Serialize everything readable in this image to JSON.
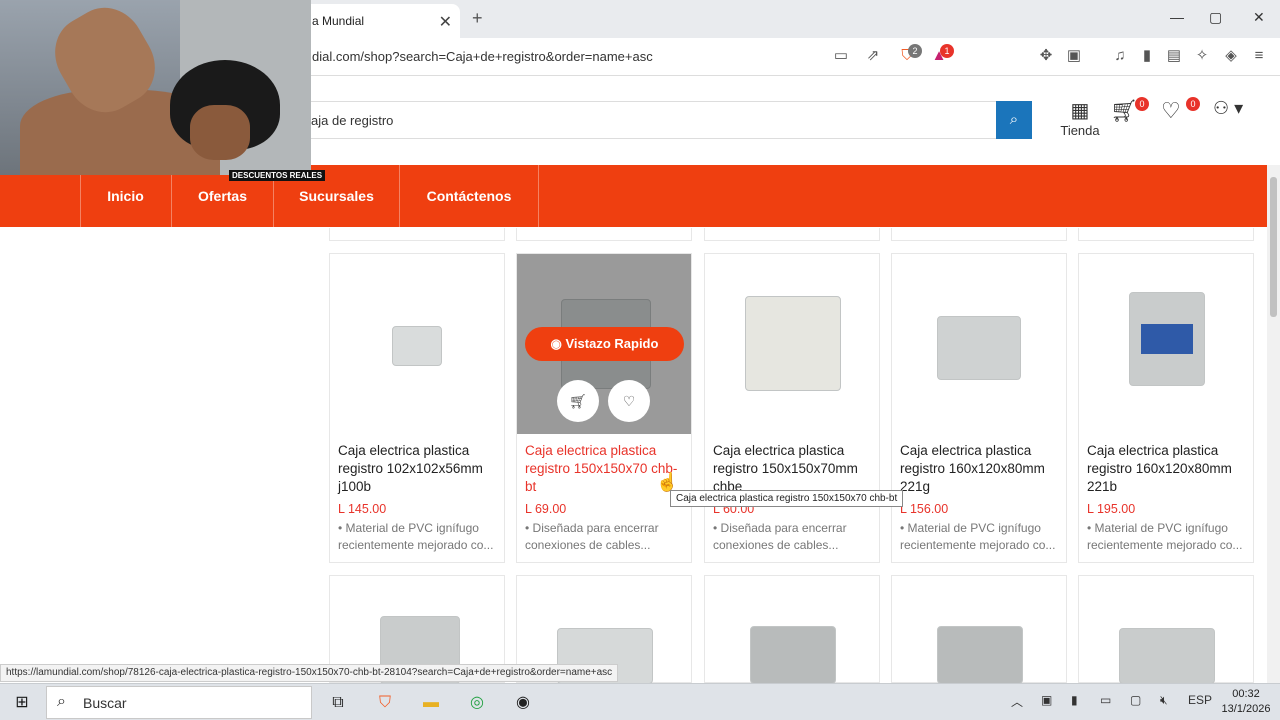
{
  "browser": {
    "tab_title": "a Mundial",
    "tab_close": "✕",
    "new_tab": "+",
    "window_controls": [
      "—",
      "▢",
      "✕"
    ],
    "url": "dial.com/shop?search=Caja+de+registro&order=name+asc",
    "shield_badge": "2",
    "alert_badge": "1"
  },
  "webcam": {
    "tag": "DESCUENTOS REALES"
  },
  "header": {
    "search_value": "aja de registro",
    "store_label": "Tienda",
    "cart_count": "0",
    "wishlist_count": "0"
  },
  "nav": {
    "items": [
      "Inicio",
      "Ofertas",
      "Sucursales",
      "Contáctenos"
    ]
  },
  "products": [
    {
      "title": "Caja electrica plastica registro 102x102x56mm j100b",
      "price": "L 145.00",
      "desc": "• Material de PVC ignífugo recientemente mejorado co..."
    },
    {
      "title": "Caja electrica plastica registro 150x150x70 chb-bt",
      "price": "L 69.00",
      "desc": "• Diseñada para encerrar conexiones de cables..."
    },
    {
      "title": "Caja electrica plastica registro 150x150x70mm chbe",
      "price": "L 60.00",
      "desc": "• Diseñada para encerrar conexiones de cables..."
    },
    {
      "title": "Caja electrica plastica registro 160x120x80mm 221g",
      "price": "L 156.00",
      "desc": "• Material de PVC ignífugo recientemente mejorado co..."
    },
    {
      "title": "Caja electrica plastica registro 160x120x80mm 221b",
      "price": "L 195.00",
      "desc": "• Material de PVC ignífugo recientemente mejorado co..."
    }
  ],
  "quick_view": "Vistazo Rapido",
  "tooltip": "Caja electrica plastica registro 150x150x70 chb-bt",
  "status_url": "https://lamundial.com/shop/78126-caja-electrica-plastica-registro-150x150x70-chb-bt-28104?search=Caja+de+registro&order=name+asc",
  "taskbar": {
    "search_placeholder": "Buscar",
    "lang": "ESP",
    "time": "00:32",
    "date": "13/1/2026"
  }
}
